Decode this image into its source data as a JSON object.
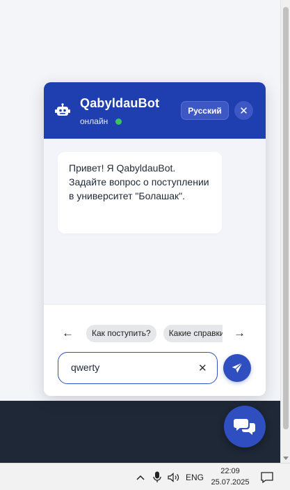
{
  "chat": {
    "bot_name": "QabyldauBot",
    "status": "онлайн",
    "language_button": "Русский",
    "close_symbol": "✕",
    "welcome_message": "Привет! Я QabyldauBot. Задайте вопрос о поступлении в университет \"Болашак\".",
    "suggestions": [
      "Как поступить?",
      "Какие справки нужны?"
    ],
    "prev_arrow": "←",
    "next_arrow": "→",
    "input_value": "qwerty",
    "clear_symbol": "✕"
  },
  "taskbar": {
    "language": "ENG",
    "time": "22:09",
    "date": "25.07.2025"
  },
  "colors": {
    "header": "#1f3fb0",
    "accent": "#2f4ec0",
    "status_online": "#3ec45d",
    "footer": "#1e2836"
  },
  "icons": {
    "bot": "robot-icon",
    "send": "paper-plane-icon",
    "launcher": "chat-bubbles-icon",
    "tray_chevron": "chevron-up-icon",
    "microphone": "microphone-icon",
    "volume": "speaker-icon",
    "notifications": "notification-icon"
  }
}
